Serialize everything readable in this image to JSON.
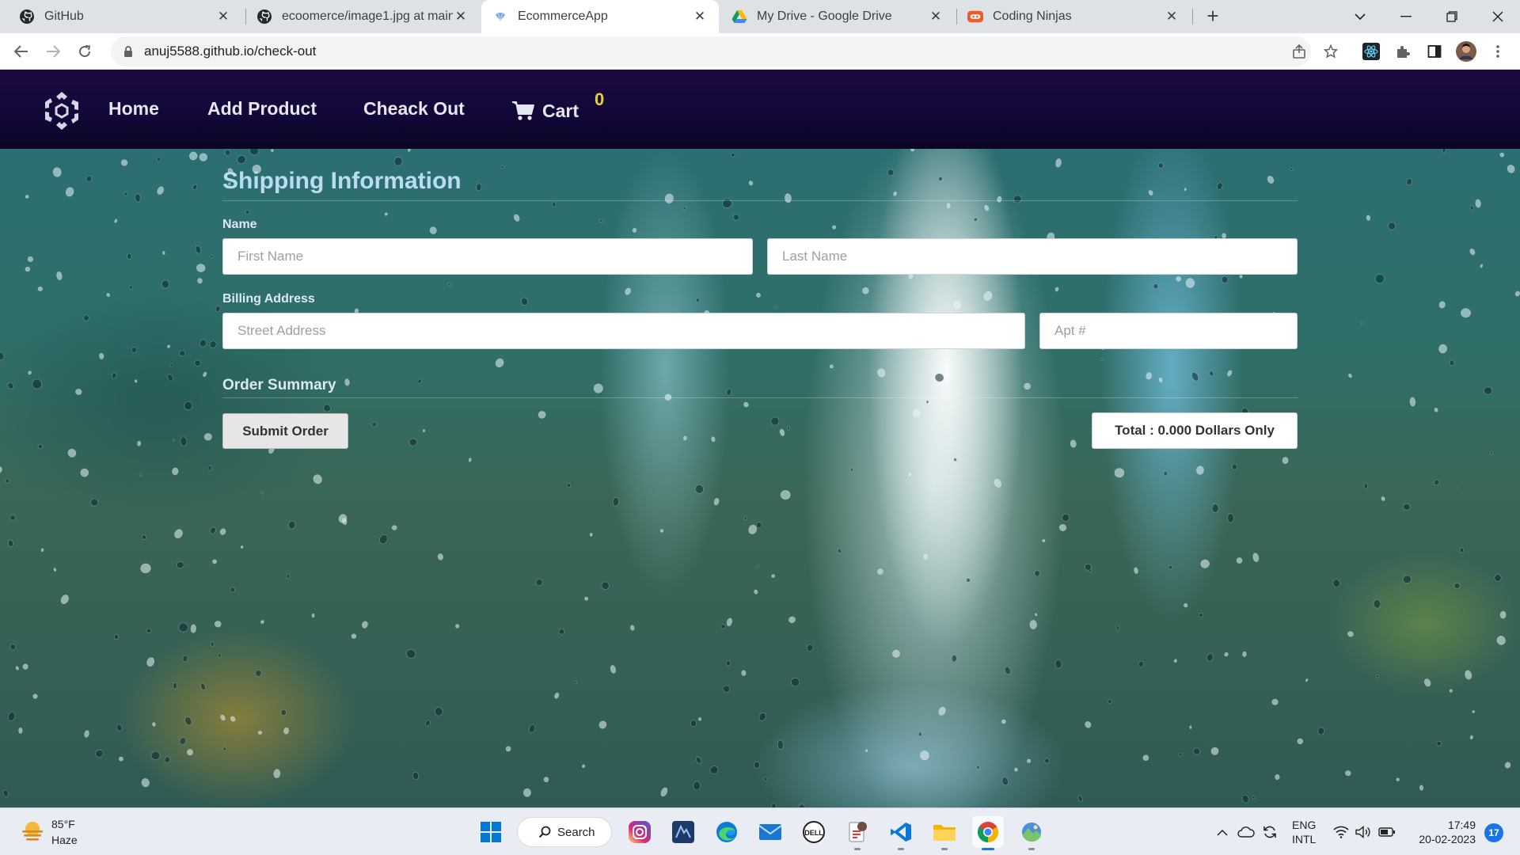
{
  "browser": {
    "tabs": [
      {
        "title": "GitHub",
        "icon": "github-icon",
        "active": false
      },
      {
        "title": "ecoomerce/image1.jpg at main ·",
        "icon": "github-icon",
        "active": false
      },
      {
        "title": "EcommerceApp",
        "icon": "app-favicon",
        "active": true
      },
      {
        "title": "My Drive - Google Drive",
        "icon": "google-drive-icon",
        "active": false
      },
      {
        "title": "Coding Ninjas",
        "icon": "coding-ninjas-icon",
        "active": false
      }
    ],
    "address": "anuj5588.github.io/check-out"
  },
  "navbar": {
    "home": "Home",
    "add_product": "Add Product",
    "checkout": "Cheack Out",
    "cart": "Cart",
    "cart_count": "0"
  },
  "form": {
    "title": "Shipping Information",
    "name_label": "Name",
    "first_name_placeholder": "First Name",
    "last_name_placeholder": "Last Name",
    "billing_label": "Billing Address",
    "street_placeholder": "Street Address",
    "apt_placeholder": "Apt #",
    "order_summary": "Order Summary",
    "submit_label": "Submit Order",
    "total_text": "Total : 0.000 Dollars Only"
  },
  "taskbar": {
    "weather_temp": "85°F",
    "weather_condition": "Haze",
    "search_label": "Search",
    "language_line1": "ENG",
    "language_line2": "INTL",
    "time": "17:49",
    "date": "20-02-2023",
    "notification_count": "17",
    "apps": [
      "windows-start-icon",
      "search-icon",
      "instagram-icon",
      "app-icon",
      "edge-icon",
      "mail-icon",
      "dell-icon",
      "file-icon",
      "vscode-icon",
      "file-explorer-icon",
      "chrome-icon",
      "photos-icon"
    ]
  },
  "colors": {
    "navbar_bg": "#120738",
    "cart_count": "#e8d42b",
    "title_color": "#b9dcf0",
    "tab_strip": "#dee1e6"
  }
}
